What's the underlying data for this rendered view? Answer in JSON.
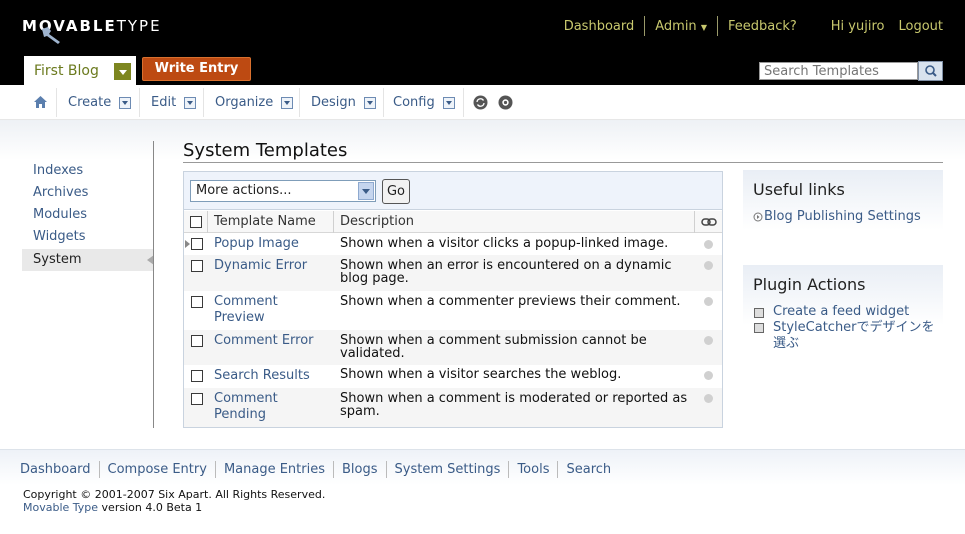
{
  "header": {
    "logo_left": "MOVABLE",
    "logo_right": "TYPE",
    "links": [
      "Dashboard",
      "Admin",
      "Feedback?"
    ],
    "greeting": "Hi yujiro",
    "logout": "Logout",
    "blog_name": "First Blog",
    "write_entry": "Write Entry",
    "search_placeholder": "Search Templates"
  },
  "nav": {
    "items": [
      "Create",
      "Edit",
      "Organize",
      "Design",
      "Config"
    ]
  },
  "sidebar": {
    "items": [
      "Indexes",
      "Archives",
      "Modules",
      "Widgets",
      "System"
    ],
    "active": "System"
  },
  "main": {
    "title": "System Templates",
    "action_select": "More actions...",
    "go_button": "Go",
    "columns": [
      "Template Name",
      "Description"
    ],
    "rows": [
      {
        "name": "Popup Image",
        "description": "Shown when a visitor clicks a popup-linked image."
      },
      {
        "name": "Dynamic Error",
        "description": "Shown when an error is encountered on a dynamic blog page."
      },
      {
        "name": "Comment Preview",
        "description": "Shown when a commenter previews their comment."
      },
      {
        "name": "Comment Error",
        "description": "Shown when a comment submission cannot be validated."
      },
      {
        "name": "Search Results",
        "description": "Shown when a visitor searches the weblog."
      },
      {
        "name": "Comment Pending",
        "description": "Shown when a comment is moderated or reported as spam."
      }
    ]
  },
  "useful_links": {
    "title": "Useful links",
    "links": [
      "Blog Publishing Settings"
    ]
  },
  "plugin_actions": {
    "title": "Plugin Actions",
    "links": [
      "Create a feed widget",
      "StyleCatcherでデザインを選ぶ"
    ]
  },
  "footer": {
    "links": [
      "Dashboard",
      "Compose Entry",
      "Manage Entries",
      "Blogs",
      "System Settings",
      "Tools",
      "Search"
    ],
    "copyright": "Copyright © 2001-2007 Six Apart. All Rights Reserved.",
    "product": "Movable Type",
    "version": "version 4.0 Beta 1"
  },
  "colors": {
    "header_bg": "#000000",
    "link": "#3a5b87",
    "header_link": "#c8c86e",
    "write_entry_bg": "#bd4a12",
    "blog_tab_text": "#6b7a1e"
  },
  "icons": [
    "wrench-icon",
    "home-icon",
    "refresh-icon",
    "view-icon",
    "search-icon",
    "link-icon",
    "plugin-icon"
  ]
}
